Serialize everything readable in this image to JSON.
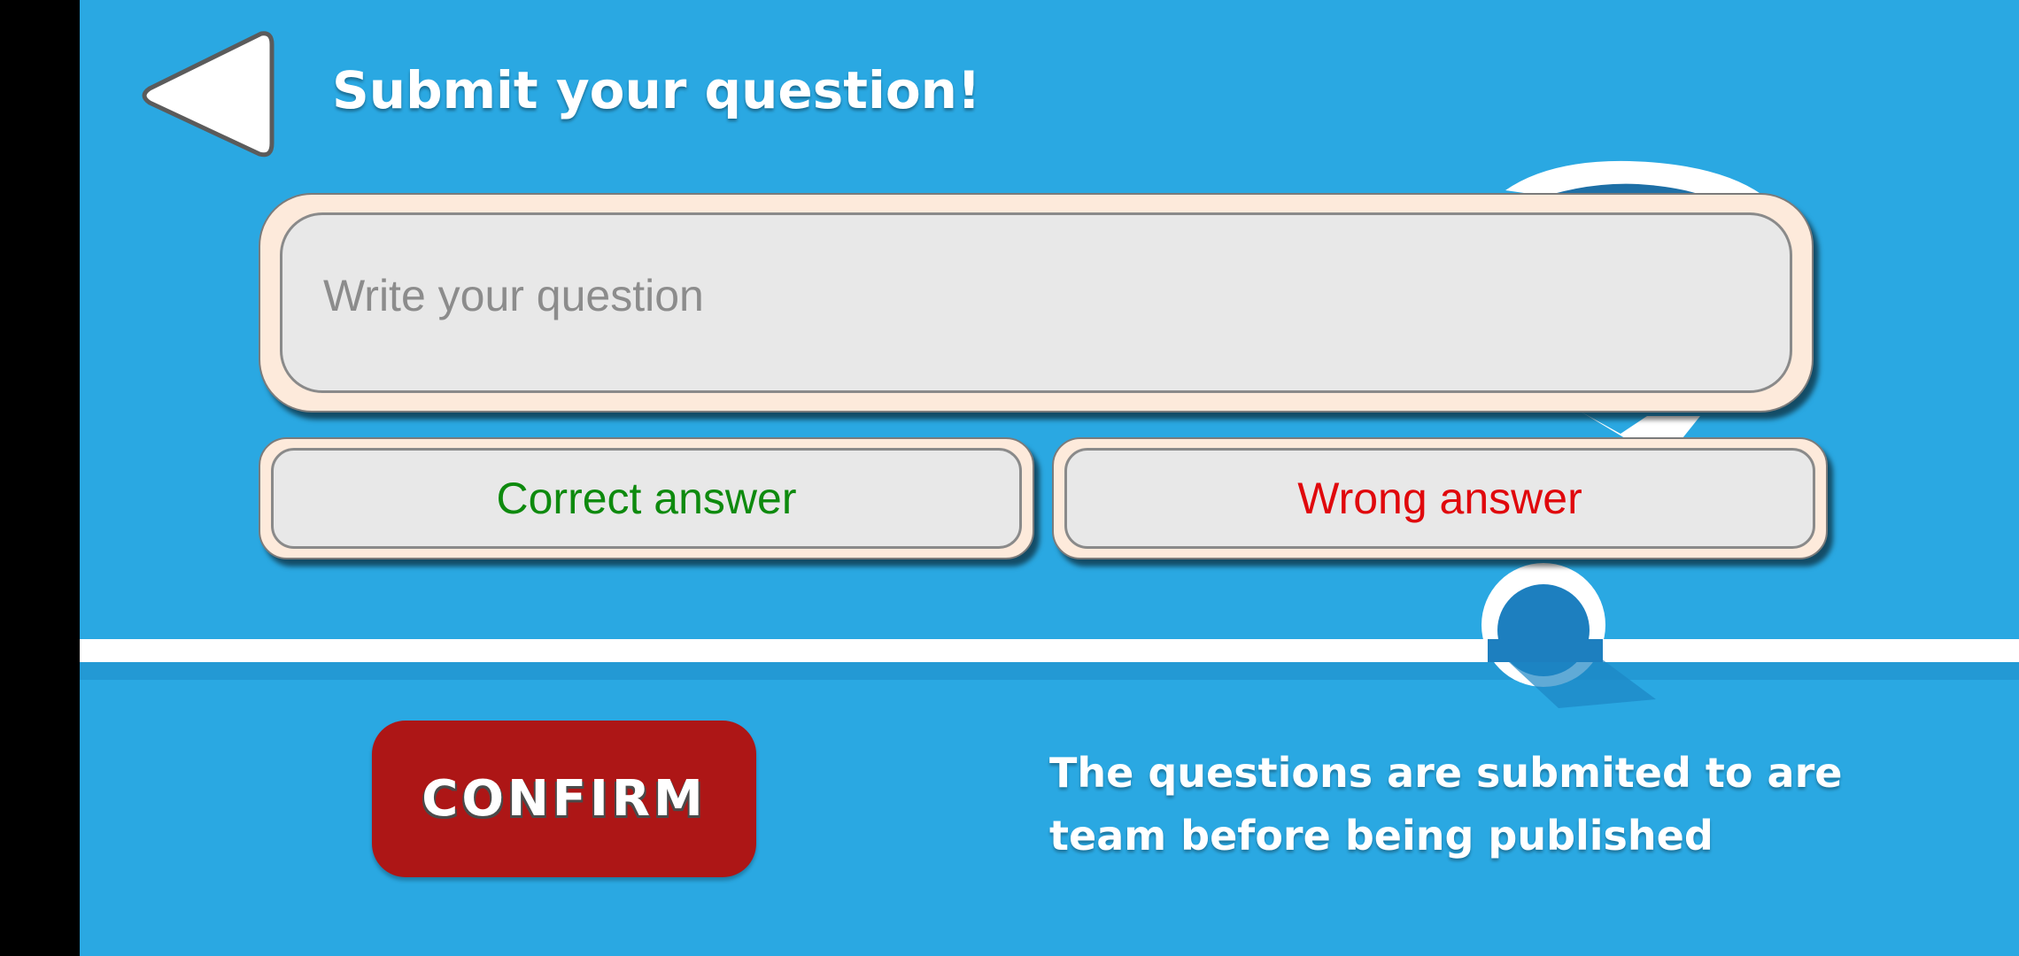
{
  "header": {
    "title": "Submit your question!",
    "back_icon": "back-triangle-icon"
  },
  "form": {
    "question_placeholder": "Write your question",
    "correct_placeholder": "Correct answer",
    "wrong_placeholder": "Wrong answer"
  },
  "footer": {
    "confirm_label": "CONFIRM",
    "note": "The questions are submited to are team before being published"
  },
  "colors": {
    "background": "#2aa8e2",
    "confirm": "#ad1616",
    "correct": "#0e8a0e",
    "wrong": "#e0080c"
  }
}
